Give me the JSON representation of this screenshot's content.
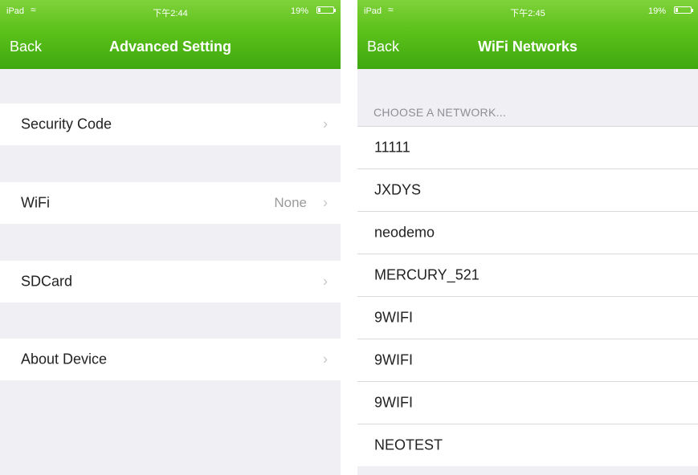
{
  "left_screen": {
    "status": {
      "carrier": "iPad",
      "time": "下午2:44",
      "battery": "19%",
      "battery_level": 0.19
    },
    "nav": {
      "back_label": "Back",
      "title": "Advanced Setting"
    },
    "rows": [
      {
        "label": "Security Code",
        "value": ""
      },
      {
        "label": "WiFi",
        "value": "None"
      },
      {
        "label": "SDCard",
        "value": ""
      },
      {
        "label": "About Device",
        "value": ""
      }
    ]
  },
  "right_screen": {
    "status": {
      "carrier": "iPad",
      "time": "下午2:45",
      "battery": "19%",
      "battery_level": 0.19
    },
    "nav": {
      "back_label": "Back",
      "title": "WiFi Networks"
    },
    "section_header": "CHOOSE A NETWORK...",
    "networks": [
      "11111",
      "JXDYS",
      "neodemo",
      "MERCURY_521",
      "9WIFI",
      "9WIFI",
      "9WIFI",
      "NEOTEST"
    ]
  },
  "colors": {
    "header_green": "#5cc11a",
    "background": "#efeff4",
    "chevron": "#c7c7cc"
  },
  "icons": {
    "wifi": "wifi-icon",
    "battery": "battery-icon",
    "chevron": "chevron-right-icon"
  }
}
